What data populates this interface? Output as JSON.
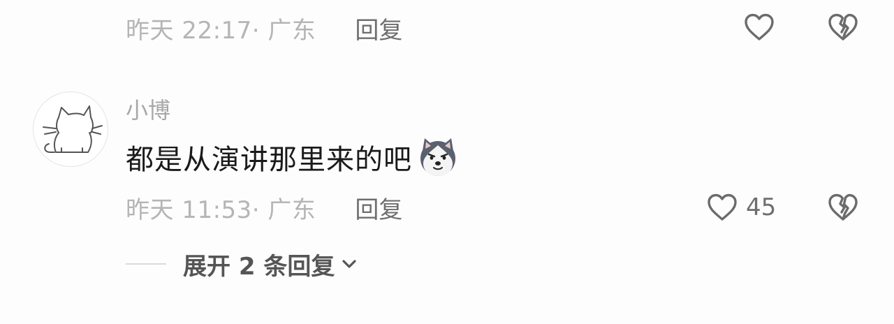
{
  "previous_comment": {
    "meta": "昨天 22:17· 广东",
    "reply_label": "回复",
    "like_icon": "heart-outline-icon",
    "dislike_icon": "broken-heart-icon"
  },
  "comment": {
    "username": "小博",
    "avatar_icon": "cat-sketch-avatar",
    "text": "都是从演讲那里来的吧",
    "emoji_icon": "husky-dog-emoji",
    "meta": "昨天 11:53· 广东",
    "reply_label": "回复",
    "like_count": "45",
    "like_icon": "heart-outline-icon",
    "dislike_icon": "broken-heart-icon"
  },
  "replies": {
    "expand_label": "展开 2 条回复",
    "chevron_icon": "chevron-down-icon"
  },
  "colors": {
    "background": "#fdfdfd",
    "meta_text": "#b5b5b5",
    "action_text": "#6e6e6e",
    "body_text": "#1a1a1a"
  }
}
